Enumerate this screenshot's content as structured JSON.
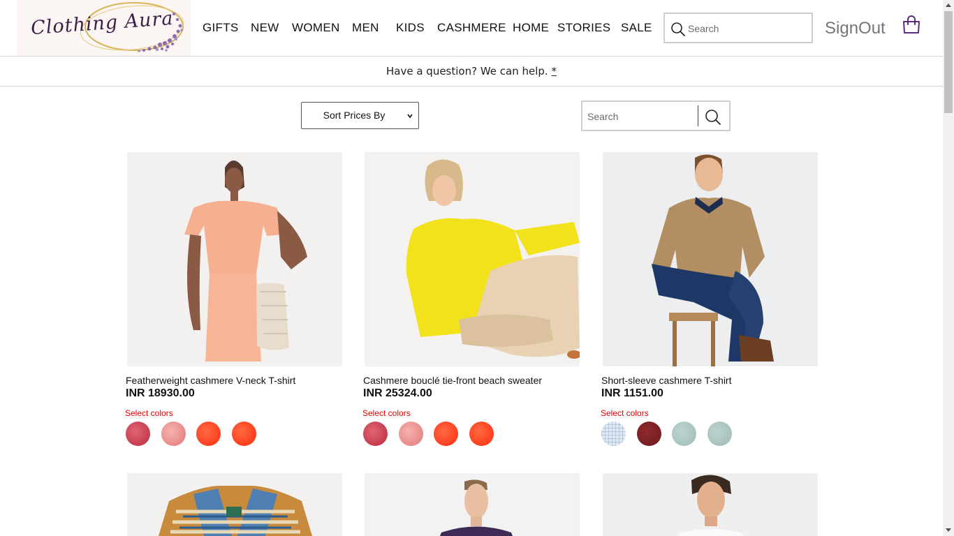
{
  "brand": {
    "name": "Clothing Aura"
  },
  "nav": {
    "items": [
      "GIFTS",
      "NEW",
      "WOMEN",
      "MEN",
      "KIDS",
      "CASHMERE",
      "HOME",
      "STORIES",
      "SALE"
    ]
  },
  "header": {
    "search_placeholder": "Search",
    "signout_label": "SignOut",
    "bag_icon": "shopping-bag-icon"
  },
  "help": {
    "text": "Have a question? We can help.",
    "link": "*"
  },
  "toolbar": {
    "sort_label": "Sort Prices By",
    "search_placeholder": "Search"
  },
  "products": [
    {
      "name": "Featherweight cashmere V-neck T-shirt",
      "price": "INR 18930.00",
      "select_label": "Select colors",
      "swatches": [
        "#cc3b4a",
        "#e98c8c",
        "#ff3b1f",
        "#ff3b1a"
      ]
    },
    {
      "name": "Cashmere bouclé tie-front beach sweater",
      "price": "INR 25324.00",
      "select_label": "Select colors",
      "swatches": [
        "#cc3b4a",
        "#e98c8c",
        "#ff3b1f",
        "#ff3b1a"
      ]
    },
    {
      "name": "Short-sleeve cashmere T-shirt",
      "price": "INR 1151.00",
      "select_label": "Select colors",
      "swatches": [
        "#cfdcec",
        "#7a1e22",
        "#a9c6c3",
        "#a8c5c0"
      ]
    },
    {
      "name": "",
      "price": "",
      "select_label": "",
      "swatches": []
    },
    {
      "name": "",
      "price": "",
      "select_label": "",
      "swatches": []
    },
    {
      "name": "",
      "price": "",
      "select_label": "",
      "swatches": []
    }
  ],
  "colors": {
    "accent_purple": "#5b2c7a",
    "select_red": "#e00000"
  }
}
